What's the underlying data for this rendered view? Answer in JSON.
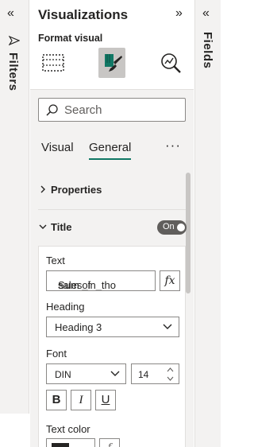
{
  "filters_pane": {
    "label": "Filters",
    "collapse_glyph": "«"
  },
  "visualizations": {
    "title": "Visualizations",
    "expand_glyph": "»",
    "subtitle": "Format visual",
    "tools": [
      {
        "icon": "table-build-icon"
      },
      {
        "icon": "format-paintbrush-icon",
        "active": true
      },
      {
        "icon": "analytics-magnifier-icon"
      }
    ],
    "search": {
      "placeholder": "Search"
    },
    "tabs": {
      "visual": "Visual",
      "general": "General",
      "more": "···",
      "active": "General"
    },
    "sections": {
      "properties": {
        "label": "Properties",
        "chevron": "›"
      },
      "title": {
        "label": "Title",
        "chevron": "⌄",
        "toggle_label": "On",
        "toggle_on": true
      }
    },
    "title_card": {
      "text_label": "Text",
      "text_value_prefix": "Sum of ",
      "text_value_misspelled": "sales_in_tho",
      "fx_label": "fx",
      "heading_label": "Heading",
      "heading_value": "Heading 3",
      "font_label": "Font",
      "font_value": "DIN",
      "font_size": "14",
      "bold_label": "B",
      "italic_label": "I",
      "underline_label": "U",
      "text_color_label": "Text color",
      "text_color": "#252423"
    }
  },
  "fields_pane": {
    "label": "Fields",
    "expand_glyph": "«"
  },
  "colors": {
    "accent": "#117865",
    "panel_bg": "#f3f2f1",
    "border": "#8a8886"
  }
}
